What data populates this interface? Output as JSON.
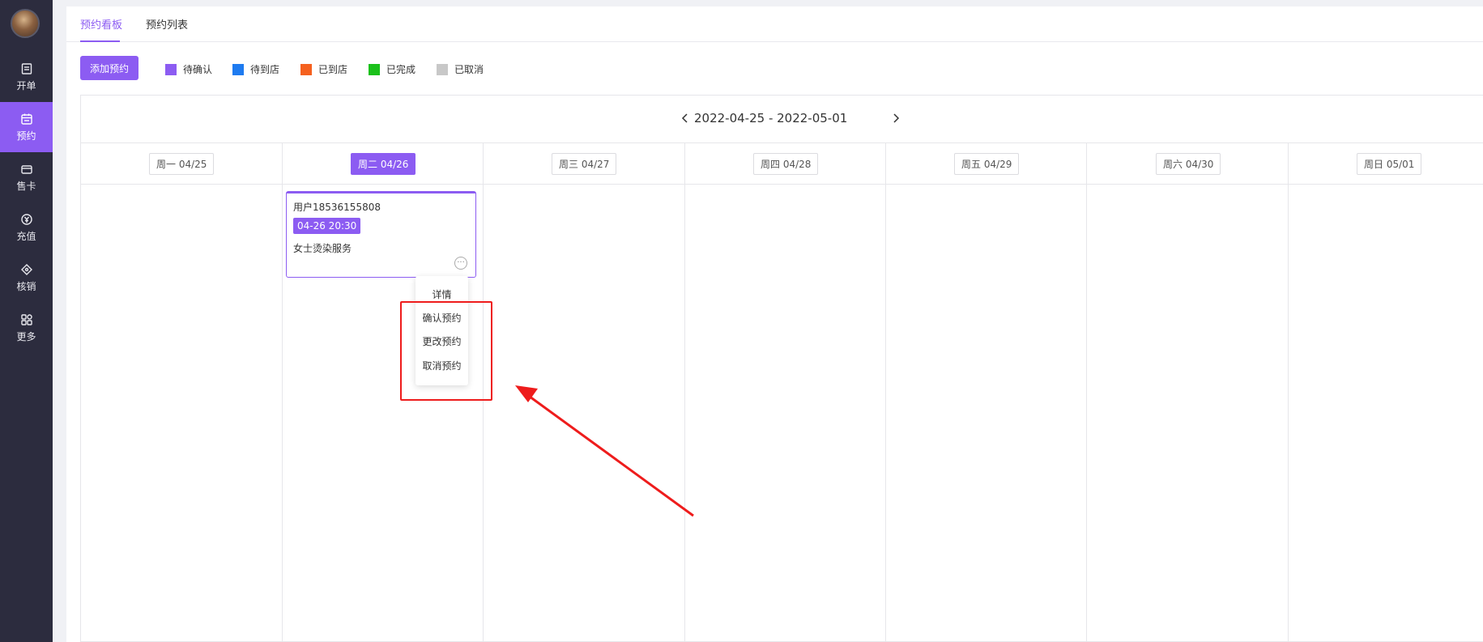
{
  "sidebar": {
    "items": [
      {
        "label": "开单",
        "icon": "receipt-icon"
      },
      {
        "label": "预约",
        "icon": "calendar-icon",
        "active": true
      },
      {
        "label": "售卡",
        "icon": "card-icon"
      },
      {
        "label": "充值",
        "icon": "yen-circle-icon"
      },
      {
        "label": "核销",
        "icon": "ticket-icon"
      },
      {
        "label": "更多",
        "icon": "grid-icon"
      }
    ]
  },
  "tabs": [
    {
      "label": "预约看板",
      "active": true
    },
    {
      "label": "预约列表",
      "active": false
    }
  ],
  "toolbar": {
    "add_label": "添加预约"
  },
  "legend": [
    {
      "label": "待确认",
      "color": "#8c5cf2"
    },
    {
      "label": "待到店",
      "color": "#1e7bf0"
    },
    {
      "label": "已到店",
      "color": "#f5611f"
    },
    {
      "label": "已完成",
      "color": "#1bc11b"
    },
    {
      "label": "已取消",
      "color": "#c8c8c8"
    }
  ],
  "calendar": {
    "range": "2022-04-25 - 2022-05-01",
    "days": [
      {
        "label": "周一 04/25",
        "active": false
      },
      {
        "label": "周二 04/26",
        "active": true
      },
      {
        "label": "周三 04/27",
        "active": false
      },
      {
        "label": "周四 04/28",
        "active": false
      },
      {
        "label": "周五 04/29",
        "active": false
      },
      {
        "label": "周六 04/30",
        "active": false
      },
      {
        "label": "周日 05/01",
        "active": false
      }
    ]
  },
  "appointment": {
    "user": "用户18536155808",
    "time": "04-26 20:30",
    "service": "女士烫染服务",
    "more": "···"
  },
  "menu": {
    "items": [
      "详情",
      "确认预约",
      "更改预约",
      "取消预约"
    ]
  },
  "colors": {
    "accent": "#8c5cf2",
    "sidebar_bg": "#2c2c3e",
    "annotation": "#ee1c1c"
  }
}
